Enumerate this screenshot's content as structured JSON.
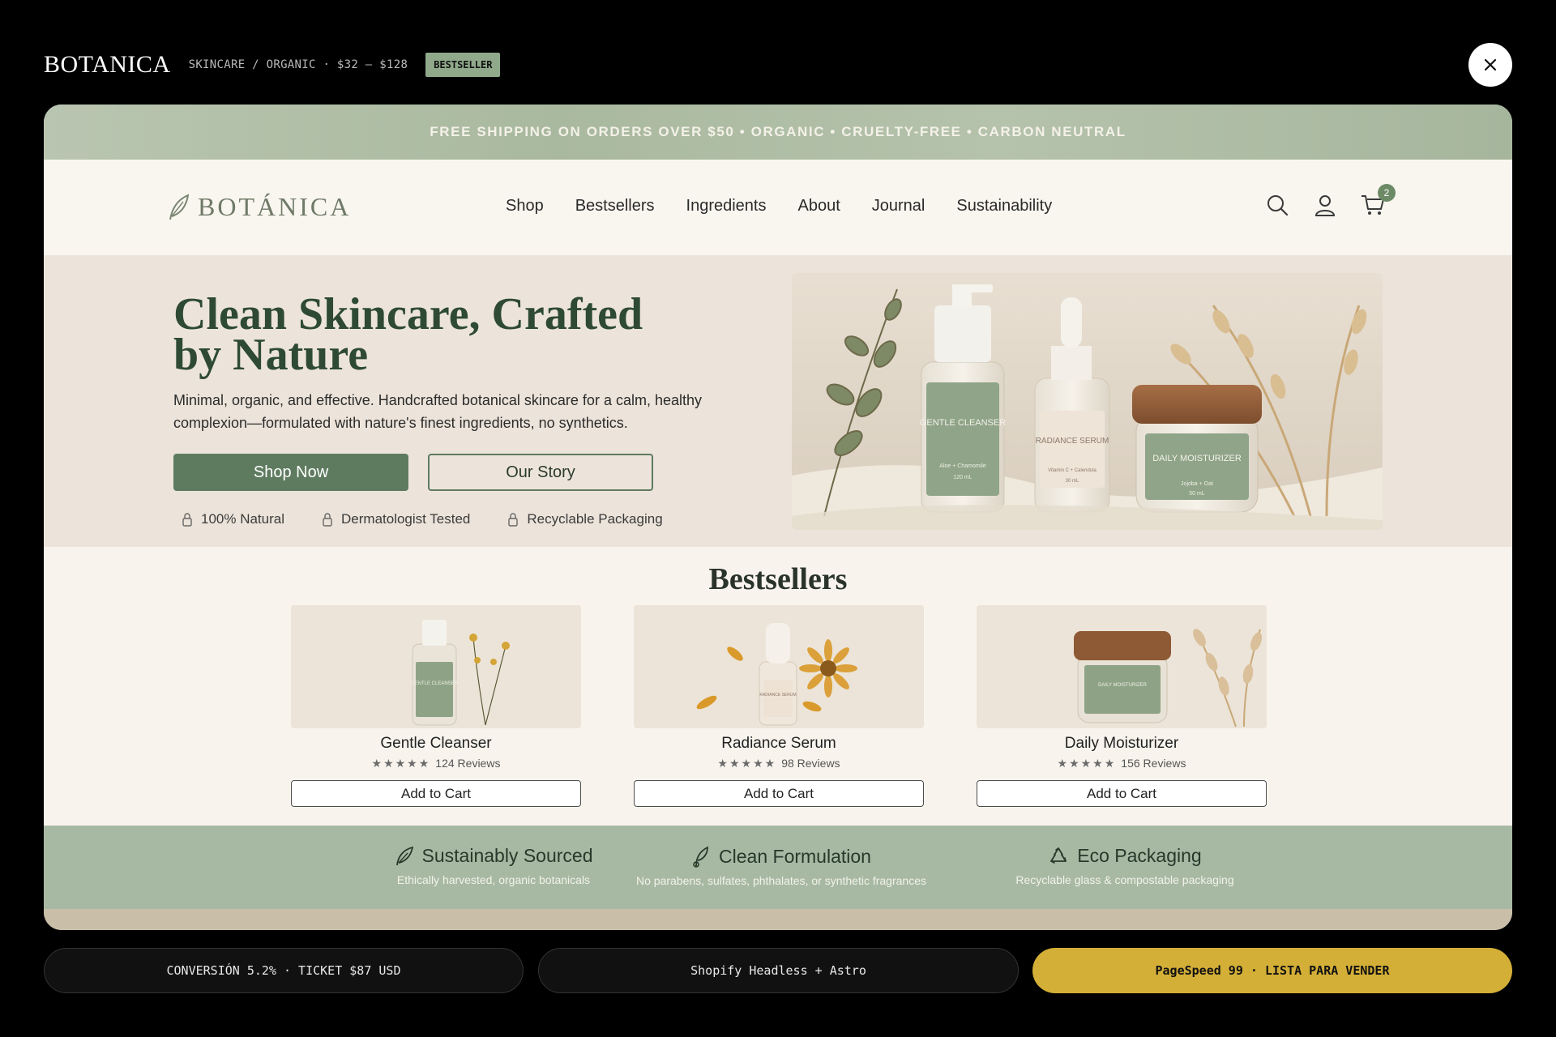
{
  "overlay": {
    "brand": "BOTANICA",
    "meta": "SKINCARE / ORGANIC · $32 – $128",
    "badge": "BESTSELLER"
  },
  "promo_bar": "FREE SHIPPING ON ORDERS OVER $50 • ORGANIC • CRUELTY-FREE • CARBON NEUTRAL",
  "nav": {
    "logo": "BOTÁNICA",
    "menu": [
      "Shop",
      "Bestsellers",
      "Ingredients",
      "About",
      "Journal",
      "Sustainability"
    ],
    "cart_count": "2",
    "icons": [
      "search-icon",
      "account-icon",
      "cart-icon"
    ]
  },
  "hero": {
    "title": "Clean Skincare, Crafted by Nature",
    "subtitle": "Minimal, organic, and effective. Handcrafted botanical skincare for a calm, healthy complexion—formulated with nature's finest ingredients, no synthetics.",
    "primary_cta": "Shop Now",
    "secondary_cta": "Our Story",
    "badges": [
      "100% Natural",
      "Dermatologist Tested",
      "Recyclable Packaging"
    ],
    "product_labels": [
      {
        "name": "GENTLE CLEANSER",
        "detail": "Aloe + Chamomile",
        "size": "120 mL"
      },
      {
        "name": "RADIANCE SERUM",
        "detail": "Vitamin C + Calendula",
        "size": "30 mL"
      },
      {
        "name": "DAILY MOISTURIZER",
        "detail": "Jojoba + Oat",
        "size": "50 mL"
      }
    ]
  },
  "bestsellers": {
    "title": "Bestsellers",
    "products": [
      {
        "name": "Gentle Cleanser",
        "stars": "★★★★★",
        "rating": 5,
        "reviews": "124 Reviews",
        "cta": "Add to Cart",
        "label": "GENTLE CLEANSER"
      },
      {
        "name": "Radiance Serum",
        "stars": "★★★★★",
        "rating": 5,
        "reviews": "98 Reviews",
        "cta": "Add to Cart",
        "label": "RADIANCE SERUM"
      },
      {
        "name": "Daily Moisturizer",
        "stars": "★★★★★",
        "rating": 5,
        "reviews": "156 Reviews",
        "cta": "Add to Cart",
        "label": "DAILY MOISTURIZER"
      }
    ]
  },
  "values": [
    {
      "title": "Sustainably Sourced",
      "subtitle": "Ethically harvested, organic botanicals",
      "icon": "leaf-icon"
    },
    {
      "title": "Clean Formulation",
      "subtitle": "No parabens, sulfates, phthalates, or synthetic fragrances",
      "icon": "sprout-icon"
    },
    {
      "title": "Eco Packaging",
      "subtitle": "Recyclable glass & compostable packaging",
      "icon": "recycle-icon"
    }
  ],
  "footer_pills": {
    "conversion": "CONVERSIÓN 5.2% · TICKET $87 USD",
    "stack": "Shopify Headless + Astro",
    "status": "PageSpeed 99 · LISTA PARA VENDER"
  },
  "colors": {
    "accent_green": "#5e7b5f",
    "promo_bg": "#b0bfa6",
    "hero_bg": "#ece4da",
    "values_bg": "#a8b9a3",
    "status_yellow": "#d4af37"
  }
}
